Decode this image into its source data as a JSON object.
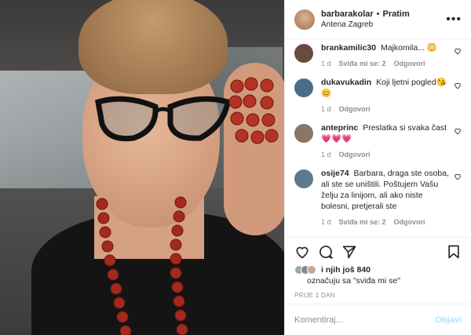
{
  "post": {
    "image_alt": "Selfie of woman with cat-eye glasses and red bead necklace"
  },
  "header": {
    "username": "barbarakolar",
    "separator": "•",
    "follow_label": "Pratim",
    "location": "Antena Zagreb",
    "more_icon": "more-icon"
  },
  "comments": [
    {
      "username": "brankamilic30",
      "text": "Majkomila... 😳",
      "time": "1 d",
      "likes": "Sviđa mi se: 2",
      "reply": "Odgovori",
      "avatar_color": "#6b4a3e"
    },
    {
      "username": "dukavukadin",
      "text": "Koji ljetni pogled😘😊",
      "time": "1 d",
      "likes": "",
      "reply": "Odgovori",
      "avatar_color": "#4a6b8a"
    },
    {
      "username": "anteprinc",
      "text": "Preslatka si svaka čast 💗💗💗",
      "time": "1 d",
      "likes": "",
      "reply": "Odgovori",
      "avatar_color": "#8a7666"
    },
    {
      "username": "osije74",
      "text": "Barbara, draga ste osoba, ali ste se uništili. Poštujem Vašu želju za linijom, ali ako niste bolesni, pretjerali ste",
      "time": "1 d",
      "likes": "Sviđa mi se: 2",
      "reply": "Odgovori",
      "avatar_color": "#5d7a8c"
    }
  ],
  "actions": {
    "like_icon": "heart-icon",
    "comment_icon": "comment-icon",
    "share_icon": "share-icon",
    "save_icon": "bookmark-icon"
  },
  "likes": {
    "line1": "i njih još 840",
    "line2": "označuju sa \"sviđa mi se\""
  },
  "timestamp": "PRIJE 1 DAN",
  "comment_box": {
    "placeholder": "Komentiraj...",
    "post_label": "Objavi"
  }
}
